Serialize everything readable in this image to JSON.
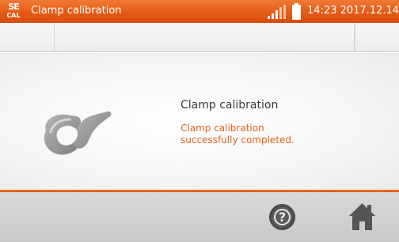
{
  "titlebar": {
    "logo_top": "SE",
    "logo_bottom": "CAL",
    "title": "Clamp calibration",
    "clock": "14:23 2017.12.14",
    "icons": [
      "signal-strength-icon",
      "battery-icon"
    ]
  },
  "message": {
    "title": "Clamp calibration",
    "status_line1": "Clamp calibration",
    "status_line2": "successfully completed."
  },
  "footer": {
    "help_glyph": "?",
    "icons": [
      "help-icon",
      "home-icon"
    ]
  },
  "colors": {
    "accent": "#e8651a",
    "status_text": "#e06418",
    "title_text": "#3a3a3a",
    "footer_bg": "#d0d0d0"
  }
}
